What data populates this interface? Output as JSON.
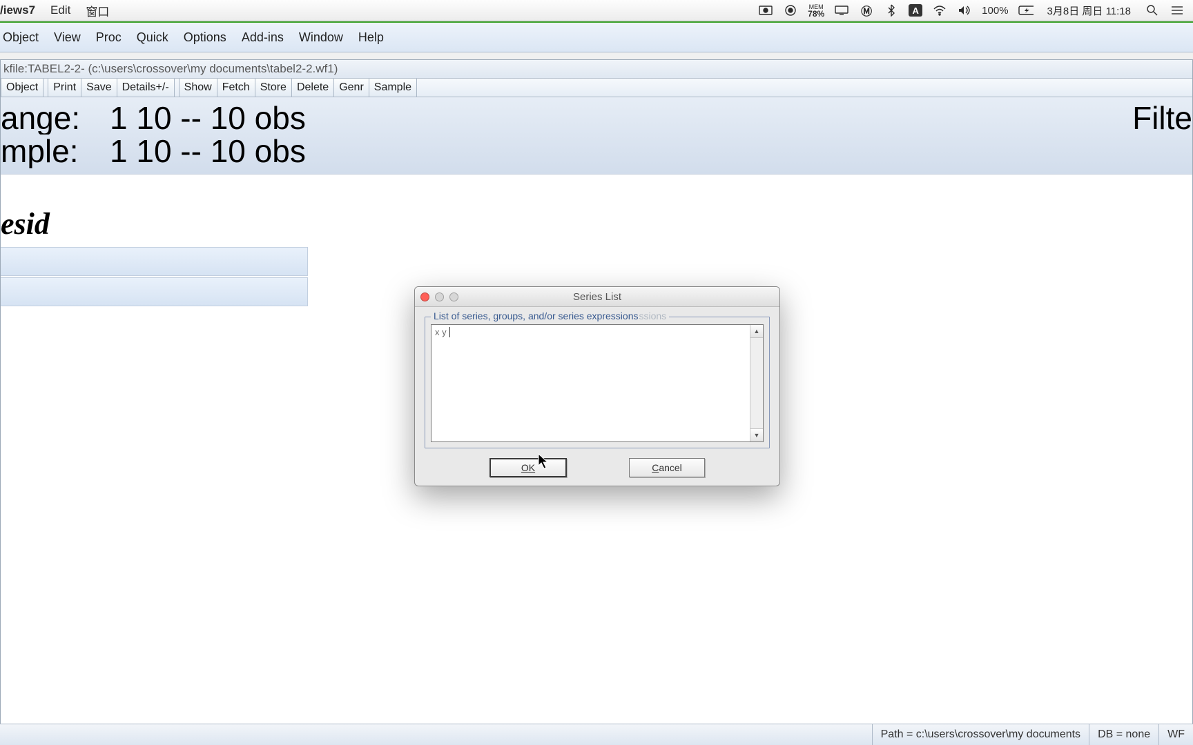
{
  "mac_menu": {
    "app_name": "/iews7",
    "items": [
      "Edit",
      "窗口"
    ],
    "mem_label": "MEM",
    "mem_pct": "78%",
    "battery_pct": "100%",
    "datetime": "3月8日 周日  11:18",
    "input_badge": "A"
  },
  "eviews_menu": [
    "Object",
    "View",
    "Proc",
    "Quick",
    "Options",
    "Add-ins",
    "Window",
    "Help"
  ],
  "workfile": {
    "title_prefix": "kfile: ",
    "title_name": "TABEL2-2",
    "title_path": " - (c:\\users\\crossover\\my documents\\tabel2-2.wf1)",
    "toolbar": [
      "Object",
      "Print",
      "Save",
      "Details+/-",
      "Show",
      "Fetch",
      "Store",
      "Delete",
      "Genr",
      "Sample"
    ],
    "range_label_cut": "ange:",
    "range_value": "1 10    --    10 obs",
    "sample_label_cut": "mple:",
    "sample_value": "1 10    --    10 obs",
    "filter_cut": "Filte",
    "series_label": "esid"
  },
  "dialog": {
    "title": "Series List",
    "legend_main": "List of series, groups, and/or series expressions",
    "legend_ghost": "ssions",
    "input_value": "x y",
    "ok": "OK",
    "cancel": "Cancel"
  },
  "statusbar": {
    "path_label": "Path = c:\\users\\crossover\\my documents",
    "db_label": "DB = none",
    "wf_label": "WF"
  }
}
